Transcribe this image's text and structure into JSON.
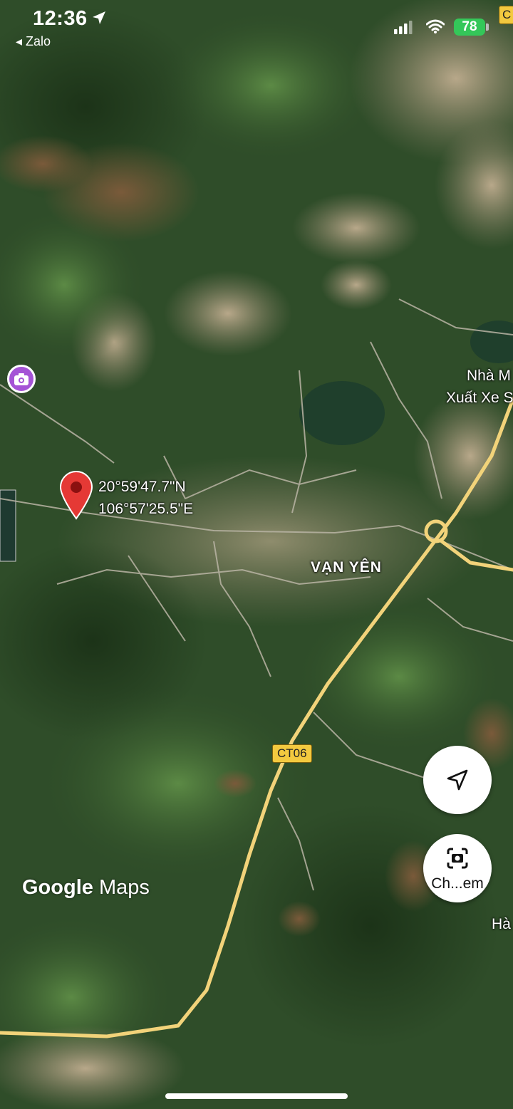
{
  "status_bar": {
    "time": "12:36",
    "back_app": "◂ Zalo",
    "battery": "78"
  },
  "map": {
    "road_label_top": "C",
    "coordinates": {
      "lat": "20°59'47.7\"N",
      "lng": "106°57'25.5\"E"
    },
    "place_labels": {
      "factory_line1": "Nhà M",
      "factory_line2": "Xuất Xe S",
      "town": "VẠN YÊN",
      "ha": "Hà"
    },
    "road_shield": "CT06",
    "logo_google": "Google",
    "logo_maps": "Maps"
  },
  "controls": {
    "navigate_icon": "navigation-arrow-icon",
    "camera_label": "Ch...em"
  },
  "colors": {
    "highway": "#f2d37a",
    "pin": "#e53935",
    "photo_pin": "#a553d6",
    "battery": "#34c759"
  }
}
